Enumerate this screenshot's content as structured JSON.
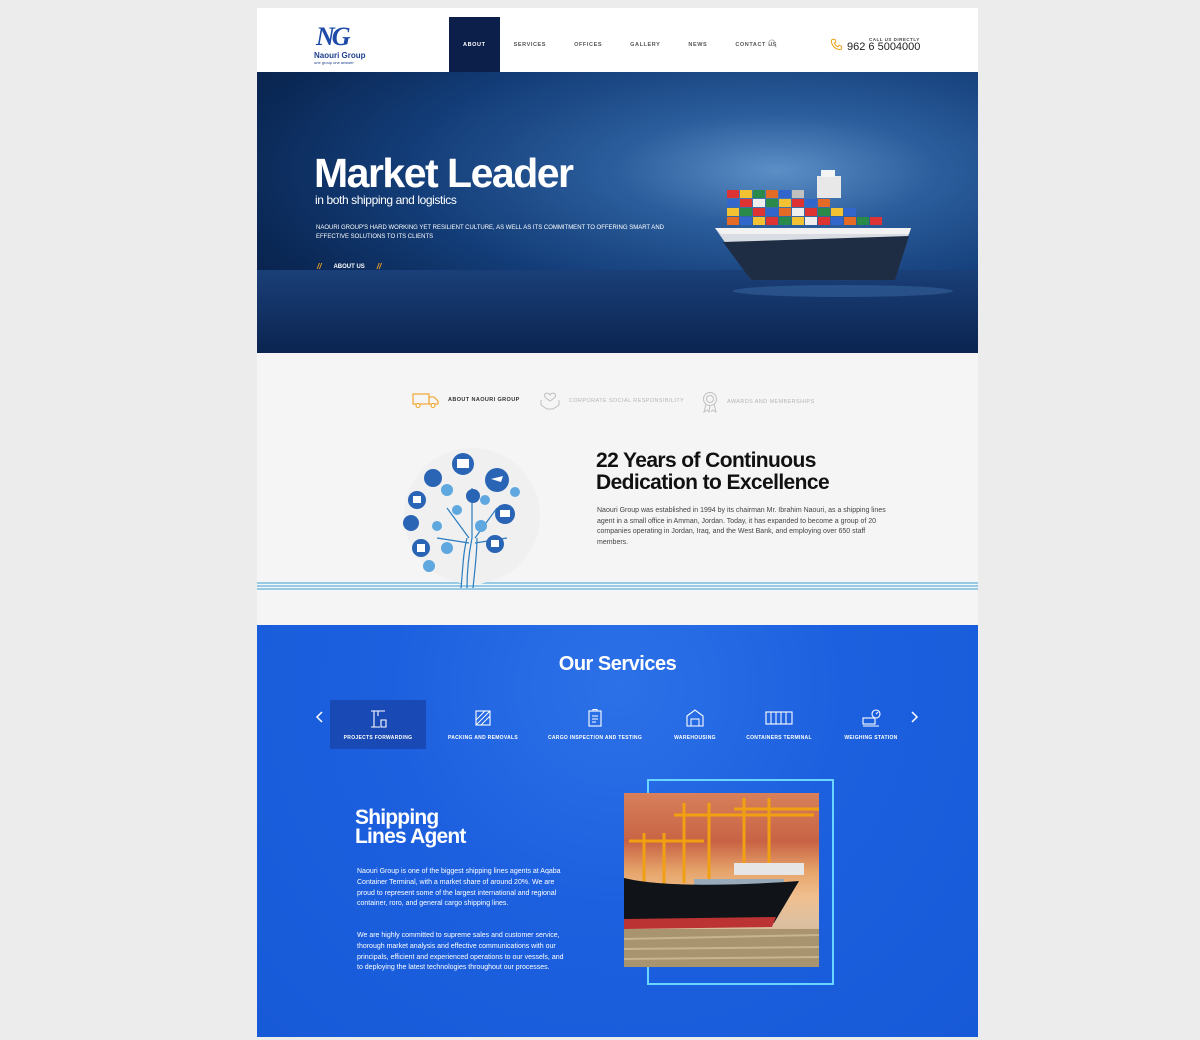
{
  "header": {
    "logo": {
      "mark": "NG",
      "name": "Naouri Group",
      "tagline": "one group one answer"
    },
    "nav": [
      {
        "label": "ABOUT",
        "active": true
      },
      {
        "label": "SERVICES",
        "active": false
      },
      {
        "label": "OFFICES",
        "active": false
      },
      {
        "label": "GALLERY",
        "active": false
      },
      {
        "label": "NEWS",
        "active": false
      },
      {
        "label": "CONTACT US",
        "active": false
      }
    ],
    "search_icon": "search-icon",
    "call_label": "CALL US DIRECTLY",
    "phone": "962 6 5004000"
  },
  "hero": {
    "title": "Market Leader",
    "subtitle": "in both shipping and logistics",
    "description": "NAOURI GROUP'S HARD WORKING YET RESILIENT CULTURE, AS WELL AS ITS COMMITMENT TO OFFERING SMART AND EFFECTIVE SOLUTIONS TO ITS CLIENTS",
    "cta": "ABOUT US",
    "cta_mark": "//"
  },
  "about": {
    "tabs": [
      {
        "label": "ABOUT NAOURI GROUP",
        "icon": "truck-icon",
        "active": true
      },
      {
        "label": "CORPORATE SOCIAL RESPONSIBILITY",
        "icon": "caring-hands-icon",
        "active": false
      },
      {
        "label": "AWARDS AND MEMBERSHIPS",
        "icon": "award-medal-icon",
        "active": false
      }
    ],
    "title_line1": "22 Years of Continuous",
    "title_line2": "Dedication to Excellence",
    "text": "Naouri Group was established in 1994 by its chairman Mr. Ibrahim Naouri, as a shipping lines agent in a small office in Amman, Jordan. Today, it has expanded to become a group of 20 companies operating in Jordan, Iraq, and the West Bank, and employing over 650 staff members."
  },
  "services": {
    "title": "Our Services",
    "items": [
      {
        "label": "PROJECTS FORWARDING",
        "icon": "crane-icon",
        "active": true
      },
      {
        "label": "PACKING AND REMOVALS",
        "icon": "crate-icon",
        "active": false
      },
      {
        "label": "CARGO INSPECTION AND TESTING",
        "icon": "inspection-clipboard-icon",
        "active": false
      },
      {
        "label": "WAREHOUSING",
        "icon": "warehouse-icon",
        "active": false
      },
      {
        "label": "CONTAINERS TERMINAL",
        "icon": "container-icon",
        "active": false
      },
      {
        "label": "WEIGHING STATION",
        "icon": "weighing-scale-icon",
        "active": false
      }
    ],
    "feature": {
      "title_line1": "Shipping",
      "title_line2": "Lines Agent",
      "paragraph1": "Naouri Group is one of the biggest shipping lines agents at Aqaba Container Terminal, with a market share of around 20%. We are proud to represent some of the largest international and regional container, roro, and general cargo shipping lines.",
      "paragraph2": "We are highly committed to supreme sales and customer service, thorough market analysis and effective communications with our principals, efficient and experienced operations to our vessels, and to deploying the latest technologies throughout our processes."
    }
  },
  "colors": {
    "nav_active": "#0c1f4a",
    "brand_blue": "#1d4aa8",
    "services_bg": "#1c60df",
    "accent_orange": "#f0a020",
    "frame_cyan": "#6ad6ff"
  }
}
